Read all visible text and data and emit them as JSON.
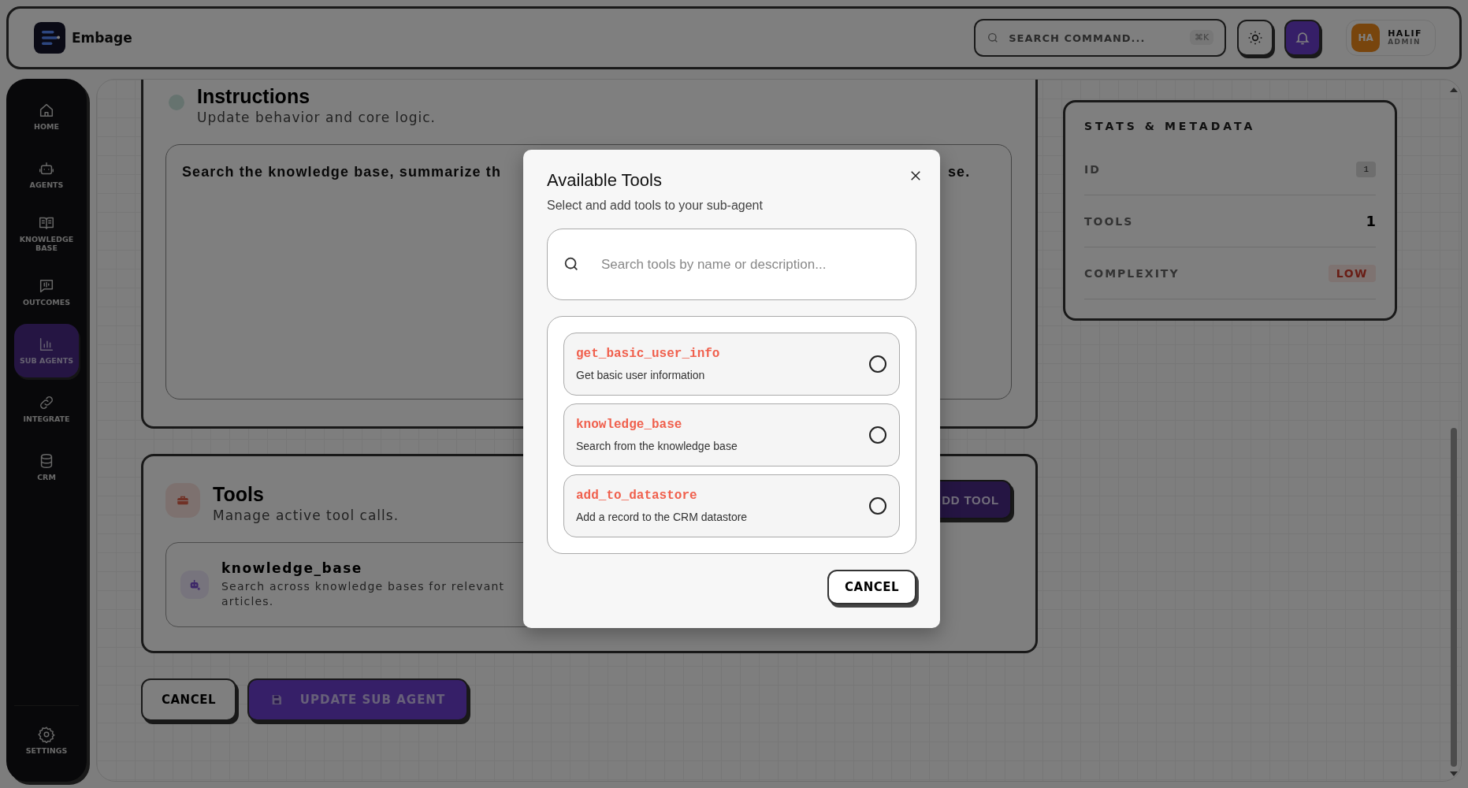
{
  "header": {
    "brand": "Embage",
    "search": {
      "placeholder": "SEARCH COMMAND...",
      "shortcut": "⌘K"
    },
    "user": {
      "initials": "HA",
      "name": "HALIF",
      "role": "ADMIN"
    }
  },
  "sidebar": {
    "items": [
      {
        "label": "HOME",
        "selected": false
      },
      {
        "label": "AGENTS",
        "selected": false
      },
      {
        "label": "KNOWLEDGE BASE",
        "selected": false
      },
      {
        "label": "OUTCOMES",
        "selected": false
      },
      {
        "label": "SUB AGENTS",
        "selected": true
      },
      {
        "label": "INTEGRATE",
        "selected": false
      },
      {
        "label": "CRM",
        "selected": false
      }
    ],
    "settings": {
      "label": "SETTINGS",
      "selected": false
    }
  },
  "instructions": {
    "title": "Instructions",
    "subtitle": "Update behavior and core logic.",
    "text_start": "Search the knowledge base, summarize th",
    "text_end": "se."
  },
  "tools_section": {
    "title": "Tools",
    "subtitle": "Manage active tool calls.",
    "add_button": "DD TOOL",
    "tools": [
      {
        "name": "knowledge_base",
        "description": "Search across knowledge bases for relevant articles."
      }
    ]
  },
  "actions": {
    "cancel": "CANCEL",
    "update": "UPDATE SUB AGENT"
  },
  "stats": {
    "title": "STATS & METADATA",
    "rows": [
      {
        "label": "ID",
        "value": "1",
        "kind": "badge"
      },
      {
        "label": "TOOLS",
        "value": "1",
        "kind": "plain"
      },
      {
        "label": "COMPLEXITY",
        "value": "LOW",
        "kind": "tag"
      }
    ]
  },
  "modal": {
    "title": "Available Tools",
    "subtitle": "Select and add tools to your sub-agent",
    "search_placeholder": "Search tools by name or description...",
    "tools": [
      {
        "name": "get_basic_user_info",
        "description": "Get basic user information",
        "selected": false
      },
      {
        "name": "knowledge_base",
        "description": "Search from the knowledge base",
        "selected": false
      },
      {
        "name": "add_to_datastore",
        "description": "Add a record to the CRM datastore",
        "selected": false
      }
    ],
    "cancel": "CANCEL"
  }
}
